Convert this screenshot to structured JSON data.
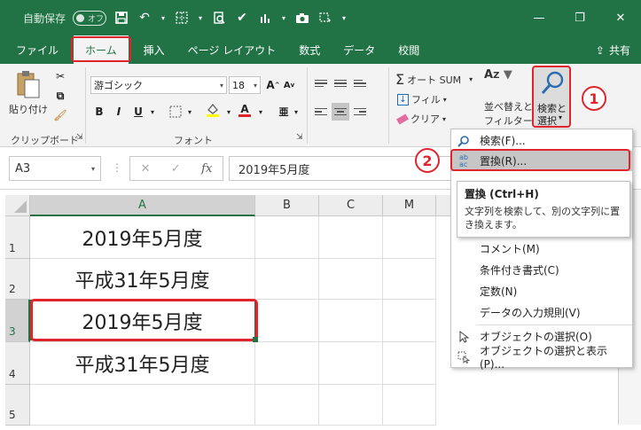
{
  "qat": {
    "autosave_label": "自動保存",
    "autosave_state": "オフ"
  },
  "tabs": [
    "ファイル",
    "ホーム",
    "挿入",
    "ページ レイアウト",
    "数式",
    "データ",
    "校閲"
  ],
  "share_label": "共有",
  "ribbon": {
    "paste_label": "貼り付け",
    "clipboard_group": "クリップボード",
    "font_name": "游ゴシック",
    "font_size": "18",
    "font_group": "フォント",
    "bold": "B",
    "italic": "I",
    "underline": "U",
    "autosum_label": "オート SUM",
    "fill_label": "フィル",
    "clear_label": "クリア",
    "sort_label_1": "並べ替えと",
    "sort_label_2": "フィルター",
    "find_label_1": "検索と",
    "find_label_2": "選択"
  },
  "formula_bar": {
    "name_box": "A3",
    "cancel": "✕",
    "enter": "✓",
    "fx": "fx",
    "value": "2019年5月度"
  },
  "columns": [
    "A",
    "B",
    "C",
    "M"
  ],
  "rows": [
    {
      "num": "1",
      "a": "2019年5月度"
    },
    {
      "num": "2",
      "a": "平成31年5月度"
    },
    {
      "num": "3",
      "a": "2019年5月度"
    },
    {
      "num": "4",
      "a": "平成31年5月度"
    },
    {
      "num": "5",
      "a": ""
    }
  ],
  "menu": {
    "find": "検索(F)...",
    "replace": "置換(R)...",
    "comment": "コメント(M)",
    "cond_format": "条件付き書式(C)",
    "constant": "定数(N)",
    "validation": "データの入力規則(V)",
    "select_objects": "オブジェクトの選択(O)",
    "selection_pane": "オブジェクトの選択と表示(P)..."
  },
  "tooltip": {
    "title": "置換 (Ctrl+H)",
    "body": "文字列を検索して、別の文字列に置き換えます。"
  },
  "callouts": [
    "1",
    "2"
  ],
  "colors": {
    "excel_green": "#217346",
    "highlight_red": "#e0242c"
  }
}
